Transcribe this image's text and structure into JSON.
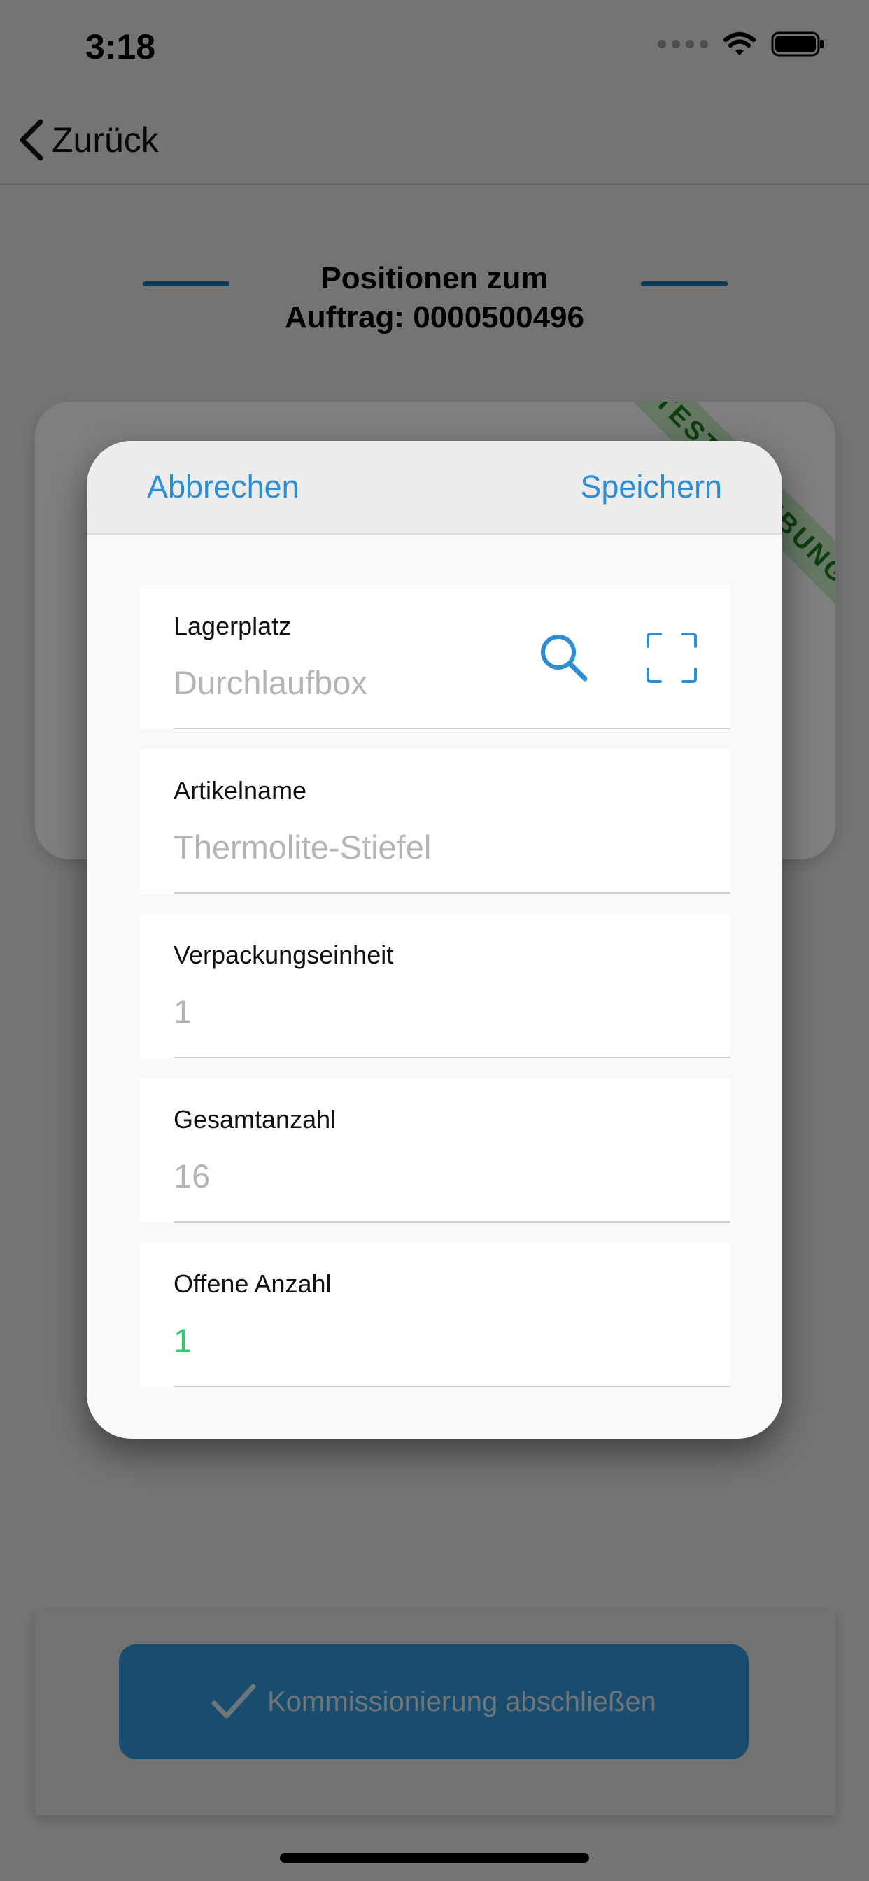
{
  "status_bar": {
    "time": "3:18"
  },
  "nav": {
    "back_label": "Zurück"
  },
  "page": {
    "title_line1": "Positionen zum",
    "title_line2": "Auftrag: 0000500496"
  },
  "background_card": {
    "ribbon_text": "TESTUMGEBUNG"
  },
  "modal": {
    "cancel_label": "Abbrechen",
    "save_label": "Speichern",
    "fields": [
      {
        "label": "Lagerplatz",
        "value": "Durchlaufbox"
      },
      {
        "label": "Artikelname",
        "value": "Thermolite-Stiefel"
      },
      {
        "label": "Verpackungseinheit",
        "value": "1"
      },
      {
        "label": "Gesamtanzahl",
        "value": "16"
      },
      {
        "label": "Offene Anzahl",
        "value": "1"
      }
    ]
  },
  "footer": {
    "finish_label": "Kommissionierung abschließen"
  },
  "colors": {
    "accent": "#2c8fd6",
    "primary_button": "#3498db",
    "open_count": "#2ecc71",
    "ribbon": "#1d7a1d"
  },
  "icons": [
    "chevron-left-icon",
    "wifi-icon",
    "battery-icon",
    "search-icon",
    "scan-frame-icon",
    "checkmark-icon"
  ]
}
